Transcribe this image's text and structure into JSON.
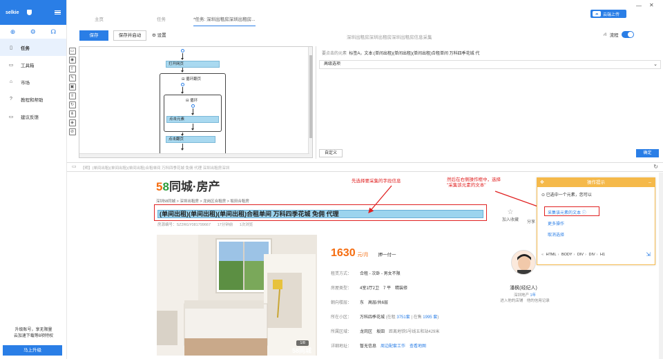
{
  "sidebar": {
    "brand": "selkie",
    "items": [
      {
        "label": "任务",
        "icon": "document-icon",
        "glyph": "▯"
      },
      {
        "label": "工具箱",
        "icon": "toolbox-icon",
        "glyph": "▭"
      },
      {
        "label": "市场",
        "icon": "store-icon",
        "glyph": "⌂"
      },
      {
        "label": "教程和帮助",
        "icon": "help-icon",
        "glyph": "?"
      },
      {
        "label": "建议反馈",
        "icon": "feedback-icon",
        "glyph": "▭"
      }
    ],
    "upgrade_text_line1": "升级账号，享无限量",
    "upgrade_text_line2": "云加速下载等8项特权",
    "upgrade_button": "马上升级"
  },
  "tabs": [
    {
      "label": "主页"
    },
    {
      "label": "任务"
    },
    {
      "label": "*任务: 深圳出租房深圳出租房..."
    }
  ],
  "cloud_button": "云端上传",
  "toolbar": {
    "save_label": "保存",
    "save_run_label": "保存并启动",
    "settings_label": "设置",
    "title": "深圳出租房深圳出租房深圳出租房信息采集",
    "flow_label": "流程"
  },
  "workflow": {
    "nodes": {
      "open_page": "打开网页",
      "loop_page": "循环翻页",
      "loop": "循环",
      "click_element": "点击元素",
      "click_page": "点击翻页"
    }
  },
  "rpanel": {
    "element_label": "要点击的元素",
    "element_value": "标签A，文本:(单间出租)(单间出租)(单间出租)合租单间 万科四季花城 代",
    "advanced": "高级选项",
    "custom": "自定义",
    "ok": "确定"
  },
  "urlbar": {
    "text": "【明】(单间出租)(单间出租)(单间出租)合租单间 万科四季花城 免佣 代理 深圳出租房深圳"
  },
  "web": {
    "logo_5": "5",
    "logo_8": "8",
    "logo_rest": "同城·房产",
    "breadcrumb": "深圳58同城 > 深圳出租房 > 龙岗区合租房 > 坂田合租房",
    "title": "(单间出租)(单间出租)(单间出租)合租单间 万科四季花城 免佣 代理",
    "house_no": "房源编号：SZ2RGY081799667",
    "updated": "17分钟前",
    "views": "1次浏览",
    "fav": "加入收藏",
    "share": "分享",
    "annotation1": "先选择要采集的字段信息",
    "annotation2_line1": "然后在右侧操作框中，选择",
    "annotation2_line2": "\"采集该元素的文本\"",
    "photo_count": "1/8",
    "watermark": "58同城",
    "price": "1630",
    "price_unit": "元/月",
    "pay_mode": "押一付一",
    "info": [
      {
        "k": "租赁方式：",
        "v": "合租 - 次卧 - 男女不限"
      },
      {
        "k": "房屋类型：",
        "v": "4室1厅2卫　7 平　精装修"
      },
      {
        "k": "朝向楼层：",
        "v": "东　高层/共6层"
      },
      {
        "k": "所在小区：",
        "v": "万科四季花城",
        "sub1": "(在租 ",
        "link1": "3751套",
        "sub2": " | 在售 ",
        "link2": "1995 套",
        "sub3": ")"
      },
      {
        "k": "所属区域：",
        "v": "龙岗区　坂田",
        "sub1": "　距离地铁5号线五和站429米"
      },
      {
        "k": "详细地址：",
        "v": "暂无信息",
        "link1": "　周边配套工作",
        "link2": "　查看地图"
      }
    ],
    "agent_name": "潘枫(经纪人)",
    "agent_meta1": "深圳地产",
    "agent_meta1_blue": "1年",
    "agent_meta2": "进入他的店铺　他的信用记录"
  },
  "hint": {
    "title": "操作提示",
    "chosen": "已选中一个元素，您可以",
    "extract_text": "采集该元素的文本",
    "more": "更多操作",
    "cancel": "取消选择",
    "path": [
      "HTML",
      "BODY",
      "DIV",
      "DIV",
      "H1"
    ]
  }
}
